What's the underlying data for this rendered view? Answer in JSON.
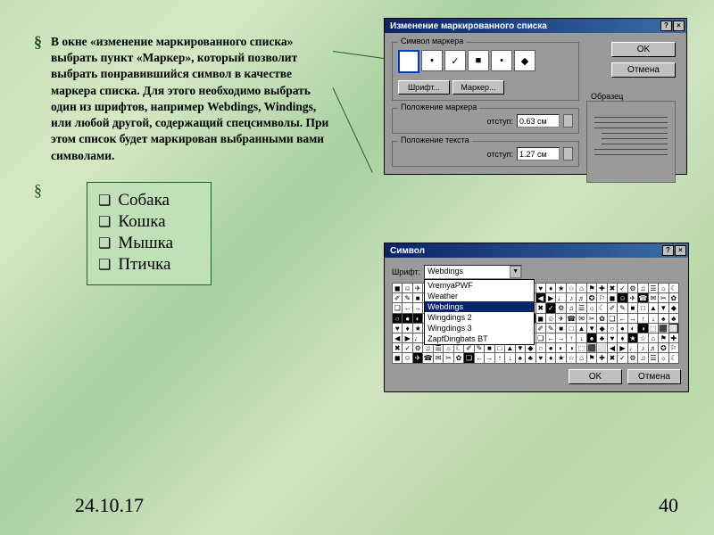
{
  "paragraph": "В окне «изменение маркированного списка» выбрать пункт «Маркер», который позволит выбрать понравившийся символ в качестве маркера списка. Для этого необходимо выбрать один из шрифтов, например Webdings, Windings, или любой другой, содержащий спецсимволы. При этом список будет маркирован выбранными вами символами.",
  "sample_list": [
    "Собака",
    "Кошка",
    "Мышка",
    "Птичка"
  ],
  "footer": {
    "date": "24.10.17",
    "page": "40"
  },
  "dialog1": {
    "title": "Изменение маркированного списка",
    "group_marker": "Символ маркера",
    "markers": [
      "",
      "•",
      "✓",
      "■",
      "•",
      "◆"
    ],
    "btn_font": "Шрифт...",
    "btn_marker": "Маркер...",
    "btn_ok": "OK",
    "btn_cancel": "Отмена",
    "group_pos_marker": "Положение маркера",
    "lbl_indent": "отступ:",
    "val_indent1": "0.63 см",
    "group_pos_text": "Положение текста",
    "val_indent2": "1.27 см",
    "group_preview": "Образец"
  },
  "dialog2": {
    "title": "Символ",
    "lbl_font": "Шрифт:",
    "font_value": "Webdings",
    "fonts": [
      "VremyaPWF",
      "Weather",
      "Webdings",
      "Wingdings 2",
      "Wingdings 3",
      "ZapfDingbats BT"
    ],
    "btn_ok": "OK",
    "btn_cancel": "Отмена"
  }
}
